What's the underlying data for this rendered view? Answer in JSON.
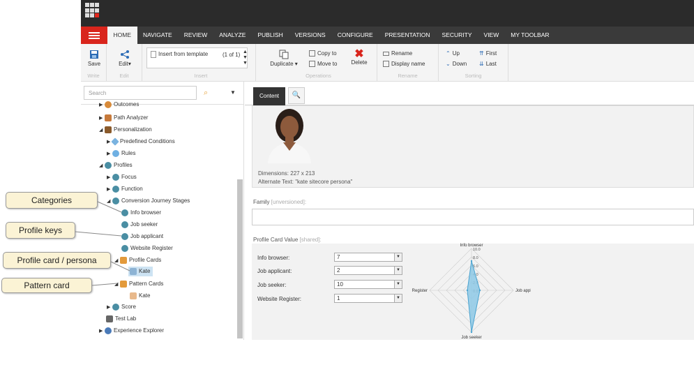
{
  "menu": {
    "tabs": [
      "HOME",
      "NAVIGATE",
      "REVIEW",
      "ANALYZE",
      "PUBLISH",
      "VERSIONS",
      "CONFIGURE",
      "PRESENTATION",
      "SECURITY",
      "VIEW",
      "MY TOOLBAR"
    ]
  },
  "ribbon": {
    "write": {
      "save": "Save",
      "group": "Write"
    },
    "edit": {
      "edit": "Edit",
      "group": "Edit"
    },
    "insert": {
      "item": "Insert from template",
      "count": "(1 of 1)",
      "group": "Insert"
    },
    "operations": {
      "duplicate": "Duplicate",
      "copy_to": "Copy to",
      "move_to": "Move to",
      "delete": "Delete",
      "group": "Operations"
    },
    "rename": {
      "rename": "Rename",
      "display_name": "Display name",
      "group": "Rename"
    },
    "sorting": {
      "up": "Up",
      "down": "Down",
      "first": "First",
      "last": "Last",
      "group": "Sorting"
    }
  },
  "search": {
    "placeholder": "Search"
  },
  "tree": {
    "outcomes": "Outcomes",
    "path_analyzer": "Path Analyzer",
    "personalization": "Personalization",
    "predefined_conditions": "Predefined Conditions",
    "rules": "Rules",
    "profiles": "Profiles",
    "focus": "Focus",
    "function": "Function",
    "conversion_journey_stages": "Conversion Journey Stages",
    "info_browser": "Info browser",
    "job_seeker": "Job seeker",
    "job_applicant": "Job applicant",
    "website_register": "Website Register",
    "profile_cards": "Profile Cards",
    "kate_profile": "Kate",
    "pattern_cards": "Pattern Cards",
    "kate_pattern": "Kate",
    "score": "Score",
    "test_lab": "Test Lab",
    "experience_explorer": "Experience Explorer"
  },
  "content": {
    "tab": "Content",
    "image": {
      "dimensions": "Dimensions: 227 x 213",
      "alt_text": "Alternate Text: \"kate sitecore persona\""
    },
    "family_label": "Family",
    "family_qualifier": "[unversioned]:",
    "pcv_label": "Profile Card Value",
    "pcv_qualifier": "[shared]:",
    "profile_values": [
      {
        "label": "Info browser:",
        "value": "7"
      },
      {
        "label": "Job applicant:",
        "value": "2"
      },
      {
        "label": "Job seeker:",
        "value": "10"
      },
      {
        "label": "Website Register:",
        "value": "1"
      }
    ]
  },
  "chart_data": {
    "type": "radar",
    "axes": [
      "Info browser",
      "Job applicant",
      "Job seeker",
      "Website Register"
    ],
    "axis_labels_shown": [
      "Info browser",
      "Job appli",
      "Job seeker",
      "s Register"
    ],
    "values": [
      7,
      2,
      10,
      1
    ],
    "rmax": 10,
    "ticks": [
      "10.0",
      "8.0",
      "6.0",
      "4.0",
      "2.0",
      "0.0"
    ],
    "fill_color": "#8ec9e6",
    "stroke_color": "#4aa3d0"
  },
  "callouts": {
    "categories": "Categories",
    "profile_keys": "Profile keys",
    "profile_card": "Profile card / persona",
    "pattern_card": "Pattern card"
  },
  "colors": {
    "brand_red": "#d9251c",
    "topbar": "#2b2b2b",
    "menubar": "#3a3a3a",
    "selection": "#cde3f3",
    "callout_bg": "#fbf3d5"
  }
}
